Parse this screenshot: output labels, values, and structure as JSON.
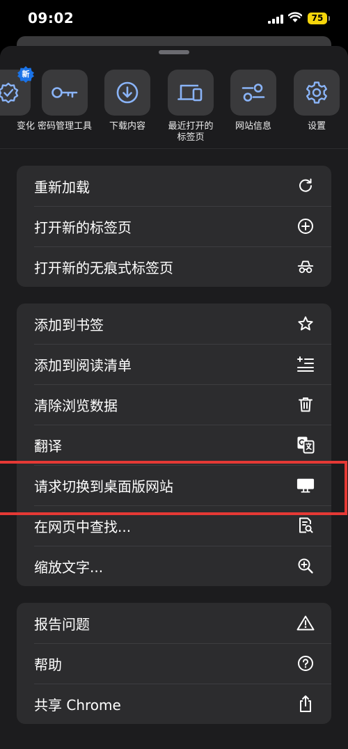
{
  "status_bar": {
    "time": "09:02",
    "battery": "75"
  },
  "quick_actions": [
    {
      "label": "变化",
      "icon": "badge-check-icon",
      "badge": "新"
    },
    {
      "label": "密码管理工具",
      "icon": "key-icon"
    },
    {
      "label": "下载内容",
      "icon": "download-icon"
    },
    {
      "label": "最近打开的\n标签页",
      "icon": "devices-icon"
    },
    {
      "label": "网站信息",
      "icon": "sliders-icon"
    },
    {
      "label": "设置",
      "icon": "gear-icon"
    }
  ],
  "menu_groups": [
    {
      "items": [
        {
          "label": "重新加载",
          "icon": "reload-icon"
        },
        {
          "label": "打开新的标签页",
          "icon": "plus-circle-icon"
        },
        {
          "label": "打开新的无痕式标签页",
          "icon": "incognito-icon"
        }
      ]
    },
    {
      "items": [
        {
          "label": "添加到书签",
          "icon": "star-icon"
        },
        {
          "label": "添加到阅读清单",
          "icon": "reading-list-icon"
        },
        {
          "label": "清除浏览数据",
          "icon": "trash-icon"
        },
        {
          "label": "翻译",
          "icon": "translate-icon"
        },
        {
          "label": "请求切换到桌面版网站",
          "icon": "desktop-icon"
        },
        {
          "label": "在网页中查找...",
          "icon": "find-in-page-icon"
        },
        {
          "label": "缩放文字...",
          "icon": "zoom-in-icon"
        }
      ]
    },
    {
      "items": [
        {
          "label": "报告问题",
          "icon": "warning-icon"
        },
        {
          "label": "帮助",
          "icon": "help-icon"
        },
        {
          "label": "共享 Chrome",
          "icon": "share-icon"
        }
      ]
    }
  ],
  "colors": {
    "accent": "#8ab4f8",
    "sheet": "#1c1c1e",
    "tile": "#3a3a3c",
    "highlight": "#e53935",
    "battery": "#f5d50b"
  }
}
